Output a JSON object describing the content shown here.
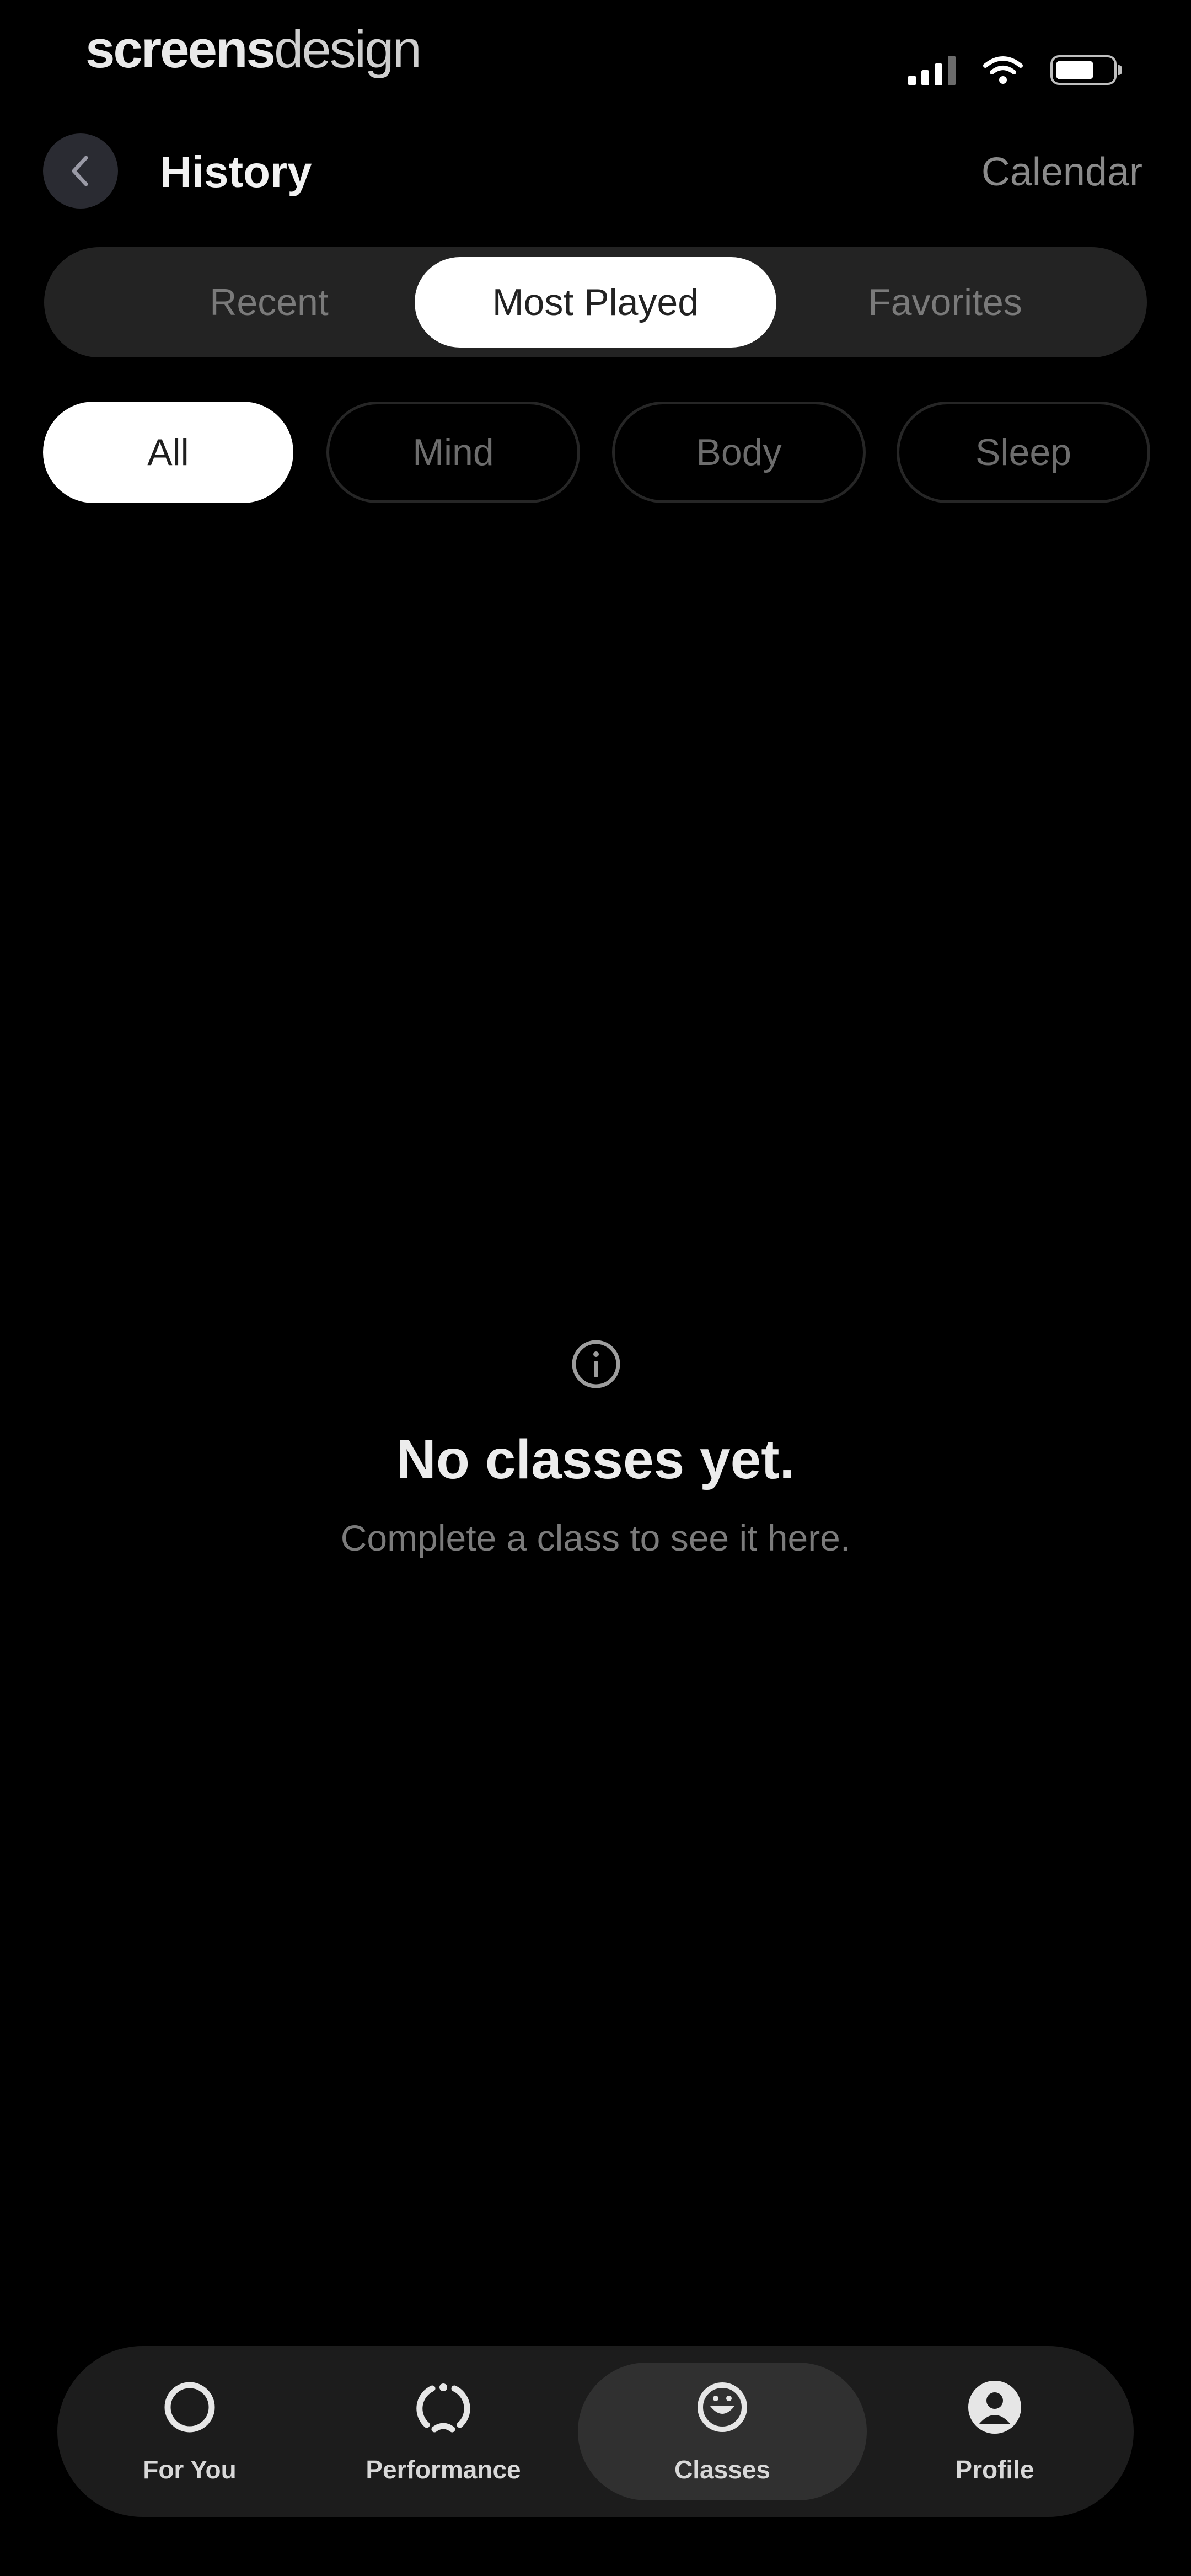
{
  "status_bar": {
    "brand_bold": "screens",
    "brand_light": "design"
  },
  "header": {
    "title": "History",
    "calendar_label": "Calendar"
  },
  "segments": [
    {
      "label": "Recent",
      "active": false
    },
    {
      "label": "Most Played",
      "active": true
    },
    {
      "label": "Favorites",
      "active": false
    }
  ],
  "filters": [
    {
      "label": "All",
      "active": true
    },
    {
      "label": "Mind",
      "active": false
    },
    {
      "label": "Body",
      "active": false
    },
    {
      "label": "Sleep",
      "active": false
    }
  ],
  "empty_state": {
    "icon": "info-icon",
    "title": "No classes yet.",
    "subtitle": "Complete a class to see it here."
  },
  "bottom_nav": [
    {
      "label": "For You",
      "icon": "ring-icon",
      "active": false
    },
    {
      "label": "Performance",
      "icon": "performance-icon",
      "active": false
    },
    {
      "label": "Classes",
      "icon": "classes-icon",
      "active": true
    },
    {
      "label": "Profile",
      "icon": "profile-icon",
      "active": false
    }
  ],
  "colors": {
    "background": "#000000",
    "surface": "#232323",
    "active_pill": "#ffffff",
    "muted_text": "#7a7a7a"
  }
}
